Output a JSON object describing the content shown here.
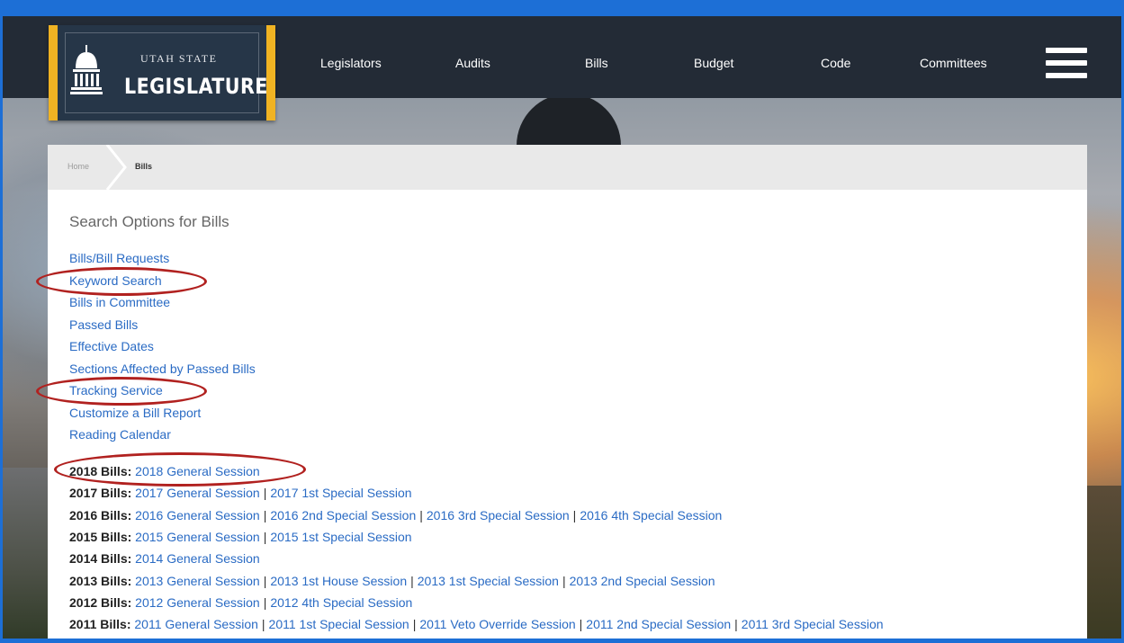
{
  "header": {
    "logo_small": "UTAH STATE",
    "logo_big": "LEGISLATURE",
    "nav": [
      {
        "label": "Legislators"
      },
      {
        "label": "Audits"
      },
      {
        "label": "Bills"
      },
      {
        "label": "Budget"
      },
      {
        "label": "Code"
      },
      {
        "label": "Committees"
      }
    ],
    "menu_icon": "hamburger-menu-icon"
  },
  "breadcrumb": {
    "home": "Home",
    "current": "Bills"
  },
  "main": {
    "title": "Search Options for Bills",
    "options": [
      {
        "label": "Bills/Bill Requests"
      },
      {
        "label": "Keyword Search"
      },
      {
        "label": "Bills in Committee"
      },
      {
        "label": "Passed Bills"
      },
      {
        "label": "Effective Dates"
      },
      {
        "label": "Sections Affected by Passed Bills"
      },
      {
        "label": "Tracking Service"
      },
      {
        "label": "Customize a Bill Report"
      },
      {
        "label": "Reading Calendar"
      }
    ],
    "years": [
      {
        "label": "2018 Bills:",
        "sessions": [
          "2018 General Session"
        ]
      },
      {
        "label": "2017 Bills:",
        "sessions": [
          "2017 General Session",
          "2017 1st Special Session"
        ]
      },
      {
        "label": "2016 Bills:",
        "sessions": [
          "2016 General Session",
          "2016 2nd Special Session",
          "2016 3rd Special Session",
          "2016 4th Special Session"
        ]
      },
      {
        "label": "2015 Bills:",
        "sessions": [
          "2015 General Session",
          "2015 1st Special Session"
        ]
      },
      {
        "label": "2014 Bills:",
        "sessions": [
          "2014 General Session"
        ]
      },
      {
        "label": "2013 Bills:",
        "sessions": [
          "2013 General Session",
          "2013 1st House Session",
          "2013 1st Special Session",
          "2013 2nd Special Session"
        ]
      },
      {
        "label": "2012 Bills:",
        "sessions": [
          "2012 General Session",
          "2012 4th Special Session"
        ]
      },
      {
        "label": "2011 Bills:",
        "sessions": [
          "2011 General Session",
          "2011 1st Special Session",
          "2011 Veto Override Session",
          "2011 2nd Special Session",
          "2011 3rd Special Session"
        ]
      }
    ]
  },
  "annotations": {
    "highlight_color": "#b1211f"
  }
}
